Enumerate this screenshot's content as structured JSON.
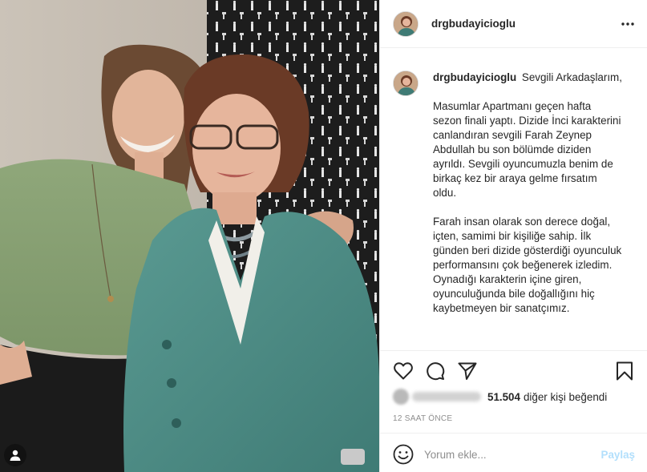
{
  "post": {
    "username": "drgbudayicioglu",
    "photo_alt": "",
    "caption": {
      "paragraphs": [
        "Sevgili Arkadaşlarım,",
        "Masumlar Apartmanı geçen hafta sezon finali yaptı. Dizide İnci karakterini canlandıran sevgili Farah Zeynep Abdullah bu son bölümde diziden ayrıldı. Sevgili oyuncumuzla benim de birkaç kez bir araya gelme fırsatım oldu.",
        "Farah insan olarak son derece doğal, içten, samimi bir kişiliğe sahip. İlk günden beri dizide gösterdiği oyunculuk performansını çok beğenerek izledim. Oynadığı karakterin içine giren, oyunculuğunda bile doğallığını hiç kaybetmeyen bir sanatçımız."
      ]
    },
    "likes": {
      "count": "51.504",
      "suffix": "diğer kişi beğendi"
    },
    "time_ago": "12 SAAT ÖNCE",
    "comment": {
      "placeholder": "Yorum ekle...",
      "value": "",
      "post_label": "Paylaş"
    }
  },
  "icons": {
    "more": "more-horizontal-icon",
    "like": "heart-icon",
    "comment": "comment-icon",
    "share": "send-icon",
    "save": "bookmark-icon",
    "emoji": "emoji-icon",
    "user_tag": "user-tag-icon"
  },
  "colors": {
    "text": "#262626",
    "muted": "#8e8e8e",
    "border": "#efefef",
    "post_button_disabled": "#b2dffc"
  }
}
